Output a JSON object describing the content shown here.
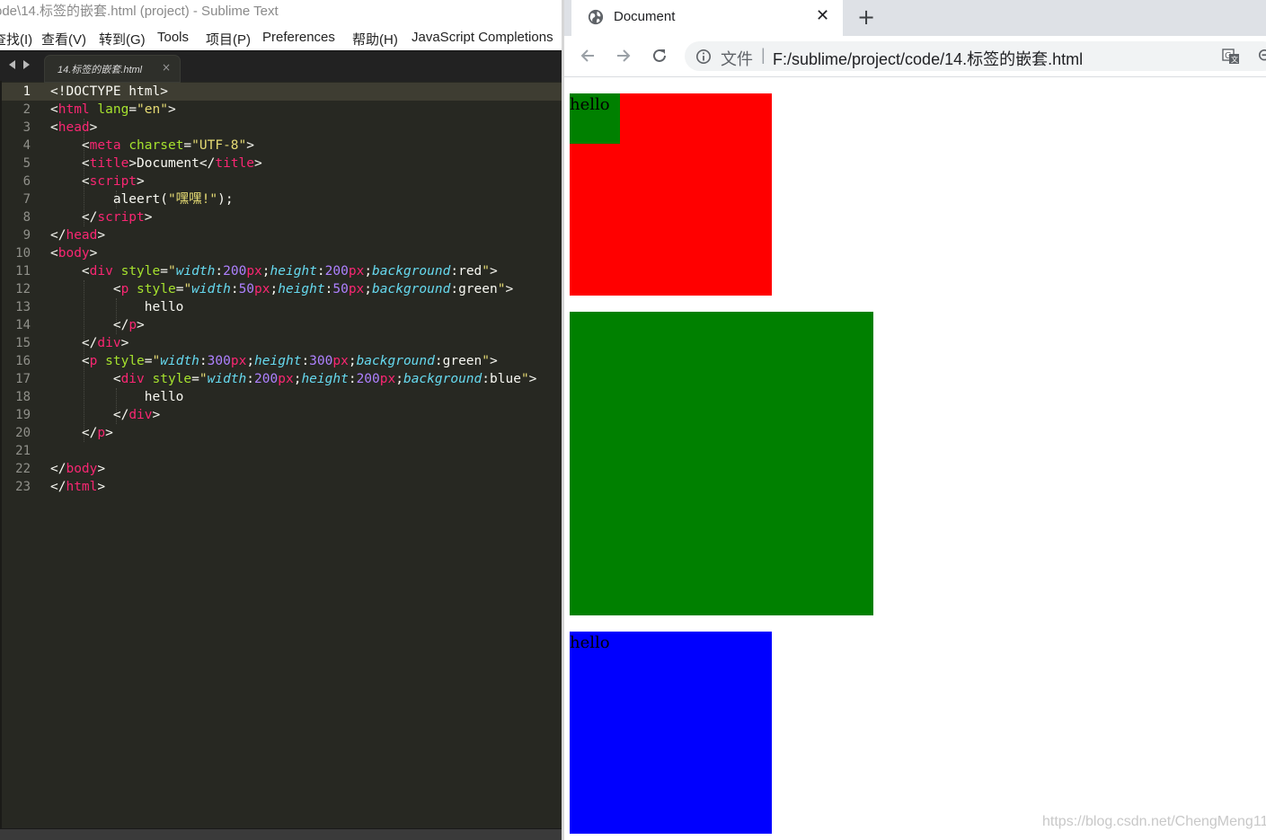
{
  "sublime": {
    "window_title": "ode\\14.标签的嵌套.html (project) - Sublime Text",
    "menu": [
      "查找(I)",
      "查看(V)",
      "转到(G)",
      "Tools",
      "项目(P)",
      "Preferences",
      "帮助(H)",
      "JavaScript Completions"
    ],
    "tab_label": "14.标签的嵌套.html",
    "tab_close": "×",
    "line_numbers": [
      "1",
      "2",
      "3",
      "4",
      "5",
      "6",
      "7",
      "8",
      "9",
      "10",
      "11",
      "12",
      "13",
      "14",
      "15",
      "16",
      "17",
      "18",
      "19",
      "20",
      "21",
      "22",
      "23"
    ],
    "active_line": "1",
    "code": {
      "l1_doctype": "<!DOCTYPE html>",
      "lang_value": "\"en\"",
      "charset_value": "\"UTF-8\"",
      "title_text": "Document",
      "script_call": "aleert(",
      "script_string": "\"嘿嘿!\"",
      "script_end": ");",
      "hello_1": "hello",
      "hello_2": "hello"
    }
  },
  "chrome": {
    "tab_title": "Document",
    "tab_close": "✕",
    "new_tab": "+",
    "omnibox_file_label": "文件",
    "omnibox_separator": "|",
    "url": "F:/sublime/project/code/14.标签的嵌套.html",
    "page": {
      "hello_1": "hello",
      "hello_2": "hello",
      "colors": {
        "red": "#ff0000",
        "green": "#008000",
        "blue": "#0000ff"
      }
    },
    "watermark": "https://blog.csdn.net/ChengMeng11"
  },
  "colors": {
    "editor_bg": "#272822",
    "tag": "#f92672",
    "attribute": "#a6e22e",
    "string": "#e6db74",
    "property": "#66d9ef",
    "number": "#ae81ff"
  }
}
